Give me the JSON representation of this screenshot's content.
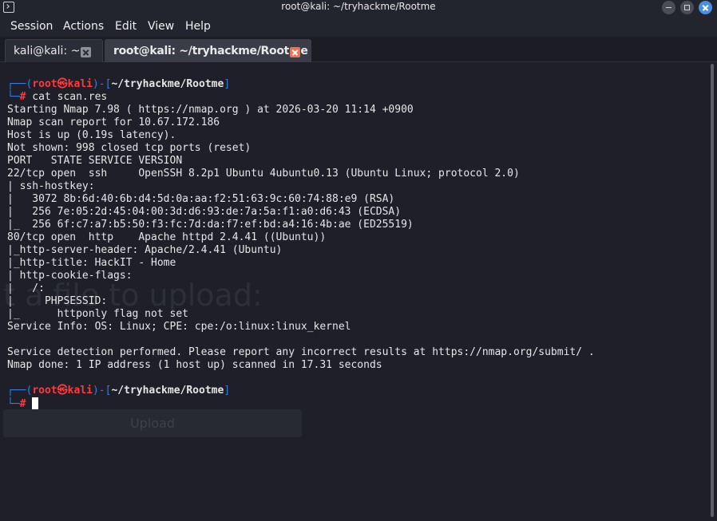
{
  "window": {
    "title": "root@kali: ~/tryhackme/Rootme"
  },
  "menu": {
    "items": [
      "Session",
      "Actions",
      "Edit",
      "View",
      "Help"
    ]
  },
  "tabs": [
    {
      "label": "kali@kali: ~"
    },
    {
      "label": "root@kali: ~/tryhackme/Rootme"
    }
  ],
  "background_ghost": {
    "text": "t a file to upload:",
    "button": "Upload"
  },
  "terminal": {
    "prompt1": {
      "open": "┌──(",
      "user": "root",
      "at": "㉿",
      "host": "kali",
      "mid": ")-[",
      "path": "~/tryhackme/Rootme",
      "close": "]",
      "corner": "└─",
      "hash": "#",
      "command": " cat scan.res"
    },
    "lines": [
      "Starting Nmap 7.98 ( https://nmap.org ) at 2026-03-20 11:14 +0900",
      "Nmap scan report for 10.67.172.186",
      "Host is up (0.19s latency).",
      "Not shown: 998 closed tcp ports (reset)",
      "PORT   STATE SERVICE VERSION",
      "22/tcp open  ssh     OpenSSH 8.2p1 Ubuntu 4ubuntu0.13 (Ubuntu Linux; protocol 2.0)",
      "| ssh-hostkey:",
      "|   3072 8b:6d:40:6b:d4:5d:0a:aa:f2:51:63:9c:60:74:88:e9 (RSA)",
      "|   256 7e:05:2d:45:04:00:3d:d6:93:de:7a:5a:f1:a0:d6:43 (ECDSA)",
      "|_  256 6f:c7:a7:b5:50:f3:fc:7d:da:f7:ef:bd:a4:16:4b:ae (ED25519)",
      "80/tcp open  http    Apache httpd 2.4.41 ((Ubuntu))",
      "|_http-server-header: Apache/2.4.41 (Ubuntu)",
      "|_http-title: HackIT - Home",
      "| http-cookie-flags:",
      "|   /:",
      "|     PHPSESSID:",
      "|_      httponly flag not set",
      "Service Info: OS: Linux; CPE: cpe:/o:linux:linux_kernel",
      "",
      "Service detection performed. Please report any incorrect results at https://nmap.org/submit/ .",
      "Nmap done: 1 IP address (1 host up) scanned in 17.31 seconds",
      ""
    ],
    "prompt2": {
      "open": "┌──(",
      "user": "root",
      "at": "㉿",
      "host": "kali",
      "mid": ")-[",
      "path": "~/tryhackme/Rootme",
      "close": "]",
      "corner": "└─",
      "hash": "#"
    }
  }
}
